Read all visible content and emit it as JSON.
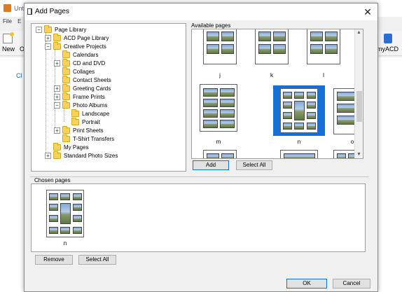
{
  "background_app": {
    "title": "Unti",
    "menu": [
      "File",
      "E"
    ],
    "toolbar": {
      "new_label": "New",
      "open_label": "O",
      "myacd_label": "myACD"
    },
    "body_link": "Cl"
  },
  "dialog": {
    "title": "Add Pages",
    "close_glyph": "✕"
  },
  "tree": {
    "items": [
      {
        "label": "Page Library",
        "expander": "−"
      },
      {
        "label": "ACD Page Library",
        "expander": "+"
      },
      {
        "label": "Creative Projects",
        "expander": "−"
      },
      {
        "label": "Calendars",
        "expander": ""
      },
      {
        "label": "CD and DVD",
        "expander": "+"
      },
      {
        "label": "Collages",
        "expander": ""
      },
      {
        "label": "Contact Sheets",
        "expander": ""
      },
      {
        "label": "Greeting Cards",
        "expander": "+"
      },
      {
        "label": "Frame Prints",
        "expander": "+"
      },
      {
        "label": "Photo Albums",
        "expander": "−"
      },
      {
        "label": "Landscape",
        "expander": ""
      },
      {
        "label": "Portrait",
        "expander": ""
      },
      {
        "label": "Print Sheets",
        "expander": "+"
      },
      {
        "label": "T-Shirt Transfers",
        "expander": ""
      },
      {
        "label": "My Pages",
        "expander": ""
      },
      {
        "label": "Standard Photo Sizes",
        "expander": "+"
      }
    ]
  },
  "available": {
    "label": "Available pages",
    "thumbs": [
      {
        "label": "j"
      },
      {
        "label": "k"
      },
      {
        "label": "l"
      },
      {
        "label": "m"
      },
      {
        "label": "n",
        "selected": true
      },
      {
        "label": "o"
      },
      {
        "label": ""
      },
      {
        "label": ""
      },
      {
        "label": ""
      }
    ],
    "scroll_up": "▲",
    "scroll_down": "▼"
  },
  "buttons": {
    "add": "Add",
    "select_all_top": "Select All",
    "remove": "Remove",
    "select_all_bottom": "Select All",
    "ok": "OK",
    "cancel": "Cancel"
  },
  "chosen": {
    "label": "Chosen pages",
    "thumbs": [
      {
        "label": "n"
      }
    ]
  },
  "colors": {
    "selection": "#1470d6",
    "folder": "#f7d35c"
  }
}
